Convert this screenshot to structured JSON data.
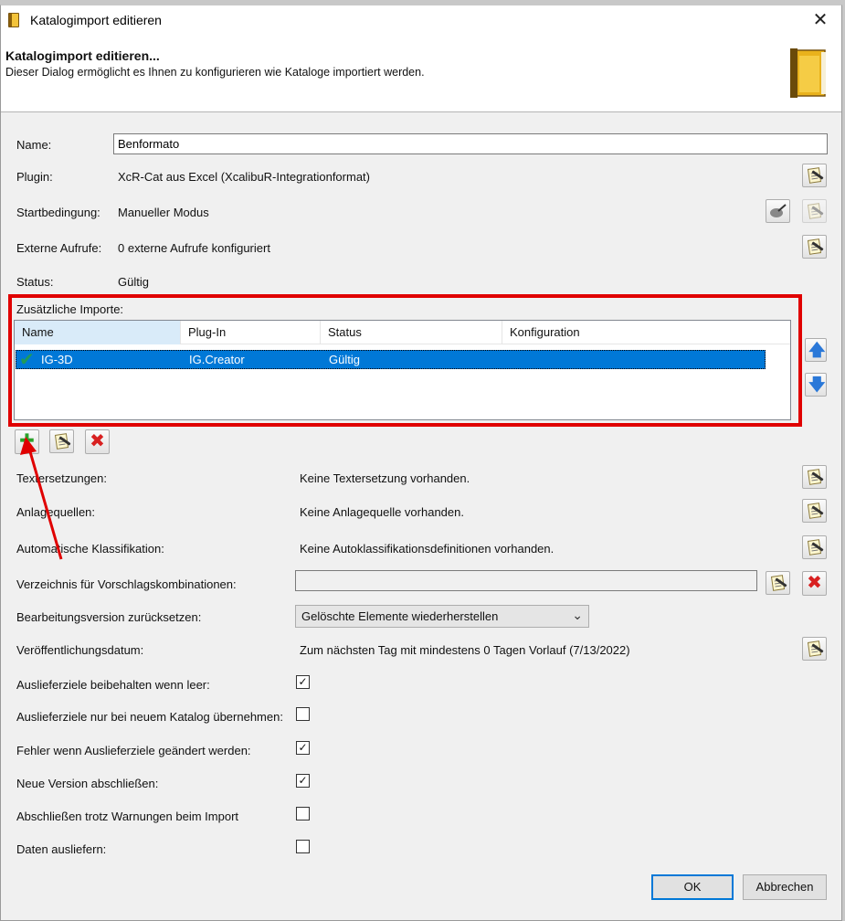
{
  "window": {
    "title": "Katalogimport editieren",
    "close_glyph": "✕"
  },
  "header": {
    "title": "Katalogimport editieren...",
    "subtitle": "Dieser Dialog ermöglicht es Ihnen zu konfigurieren wie Kataloge importiert werden.",
    "icon": "book-icon"
  },
  "fields": {
    "name_label": "Name:",
    "name_value": "Benformato",
    "plugin_label": "Plugin:",
    "plugin_value": "XcR-Cat aus Excel (XcalibuR-Integrationformat)",
    "start_label": "Startbedingung:",
    "start_value": "Manueller Modus",
    "external_label": "Externe Aufrufe:",
    "external_value": "0 externe Aufrufe konfiguriert",
    "status_label": "Status:",
    "status_value": "Gültig"
  },
  "imports": {
    "label": "Zusätzliche Importe:",
    "columns": [
      "Name",
      "Plug-In",
      "Status",
      "Konfiguration"
    ],
    "rows": [
      {
        "name": "IG-3D",
        "plugin": "IG.Creator",
        "status": "Gültig",
        "config": "",
        "check": "✔"
      }
    ]
  },
  "toolbar": {
    "add_glyph": "✚",
    "delete_glyph": "✖",
    "up_glyph": "🡅",
    "down_glyph": "🡇"
  },
  "settings": {
    "text_label": "Textersetzungen:",
    "text_value": "Keine Textersetzung vorhanden.",
    "source_label": "Anlagequellen:",
    "source_value": "Keine Anlagequelle vorhanden.",
    "class_label": "Automatische Klassifikation:",
    "class_value": "Keine Autoklassifikationsdefinitionen vorhanden.",
    "dir_label": "Verzeichnis für Vorschlagskombinationen:",
    "dir_value": "",
    "reset_label": "Bearbeitungsversion zurücksetzen:",
    "reset_value": "Gelöschte Elemente wiederherstellen",
    "publish_label": "Veröffentlichungsdatum:",
    "publish_value": "Zum nächsten Tag mit mindestens 0 Tagen Vorlauf (7/13/2022)"
  },
  "checks": [
    {
      "label": "Auslieferziele beibehalten wenn leer:",
      "checked": true
    },
    {
      "label": "Auslieferziele nur bei neuem Katalog übernehmen:",
      "checked": false
    },
    {
      "label": "Fehler wenn Auslieferziele geändert werden:",
      "checked": true
    },
    {
      "label": "Neue Version abschließen:",
      "checked": true
    },
    {
      "label": "Abschließen trotz Warnungen beim Import",
      "checked": false
    },
    {
      "label": "Daten ausliefern:",
      "checked": false
    }
  ],
  "buttons": {
    "ok": "OK",
    "cancel": "Abbrechen"
  },
  "colors": {
    "highlight_box": "#e00000",
    "selection": "#0078d7",
    "annotation_arrow": "#e00000"
  }
}
